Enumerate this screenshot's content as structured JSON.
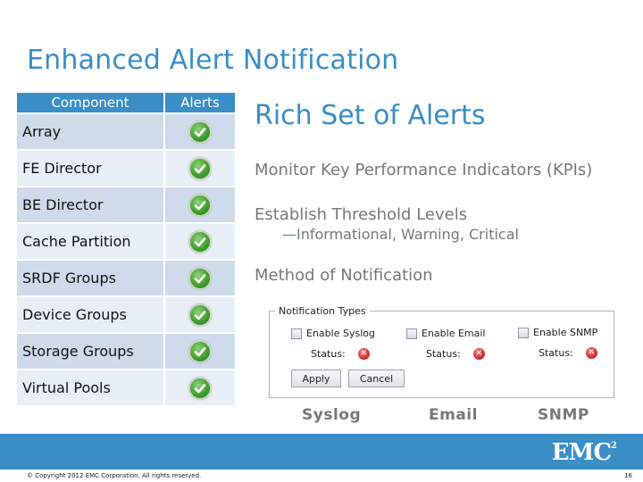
{
  "title": "Enhanced Alert Notification",
  "table": {
    "headers": [
      "Component",
      "Alerts"
    ],
    "rows": [
      {
        "component": "Array",
        "alert": "check-icon"
      },
      {
        "component": "FE Director",
        "alert": "check-icon"
      },
      {
        "component": "BE Director",
        "alert": "check-icon"
      },
      {
        "component": "Cache Partition",
        "alert": "check-icon"
      },
      {
        "component": "SRDF Groups",
        "alert": "check-icon"
      },
      {
        "component": "Device Groups",
        "alert": "check-icon"
      },
      {
        "component": "Storage Groups",
        "alert": "check-icon"
      },
      {
        "component": "Virtual Pools",
        "alert": "check-icon"
      }
    ]
  },
  "content": {
    "heading": "Rich Set of Alerts",
    "bullets": [
      "Monitor Key Performance Indicators (KPIs)",
      "Establish Threshold Levels",
      "Method of Notification"
    ],
    "sub_bullet": "Informational, Warning, Critical",
    "sub_dash": "—"
  },
  "dialog": {
    "legend": "Notification Types",
    "checkboxes": [
      {
        "label": "Enable Syslog",
        "checked": false
      },
      {
        "label": "Enable Email",
        "checked": false
      },
      {
        "label": "Enable SNMP",
        "checked": false
      }
    ],
    "status_label": "Status:",
    "status_icon": "error-icon",
    "apply": "Apply",
    "cancel": "Cancel"
  },
  "captions": [
    "Syslog",
    "Email",
    "SNMP"
  ],
  "footer": {
    "logo": "EMC",
    "logo_sup": "2",
    "copyright": "© Copyright 2012 EMC Corporation. All rights reserved.",
    "page": "16"
  },
  "colors": {
    "accent": "#3a8dc5",
    "row_dark": "#cfdbea",
    "row_light": "#e8eef6",
    "check_green": "#3d9a2a",
    "error_red": "#d0262a"
  }
}
